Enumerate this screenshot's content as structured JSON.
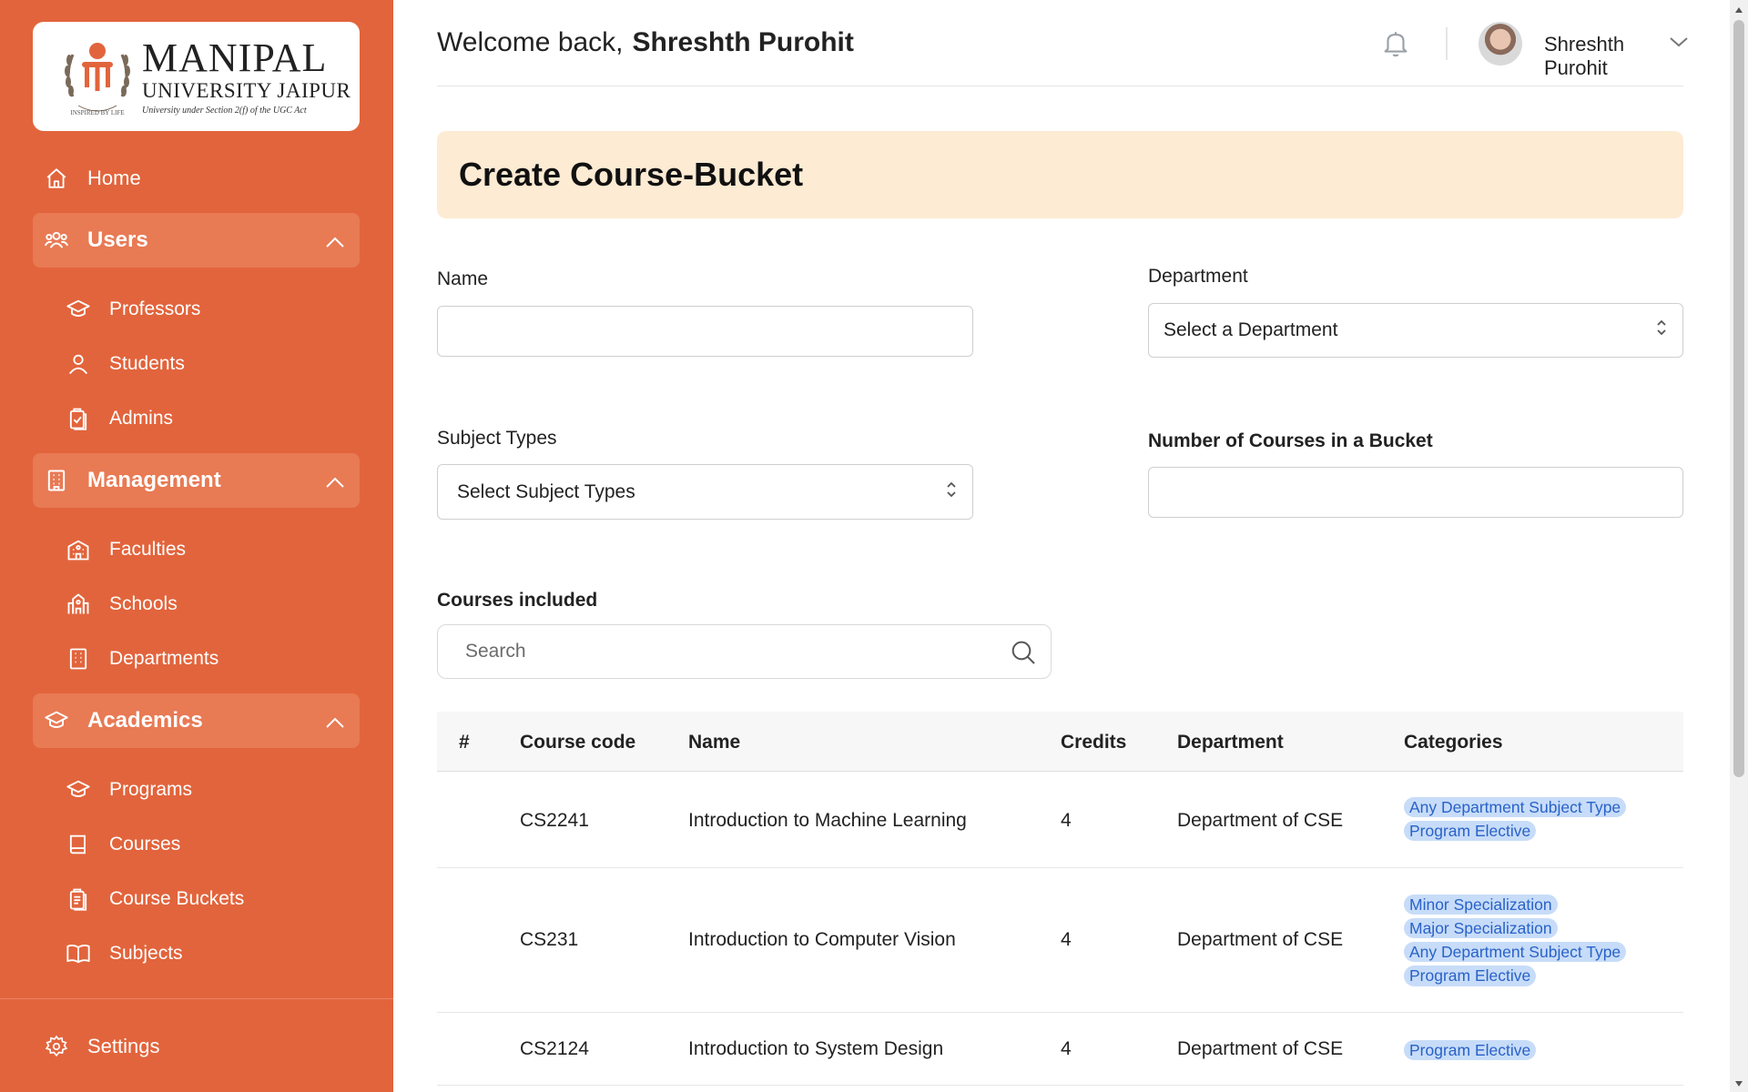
{
  "logo": {
    "line1": "MANIPAL",
    "line2": "UNIVERSITY JAIPUR",
    "line3": "University under Section 2(f) of the UGC Act",
    "tagline": "INSPIRED BY LIFE"
  },
  "sidebar": {
    "home": "Home",
    "users": {
      "label": "Users",
      "items": [
        "Professors",
        "Students",
        "Admins"
      ]
    },
    "management": {
      "label": "Management",
      "items": [
        "Faculties",
        "Schools",
        "Departments"
      ]
    },
    "academics": {
      "label": "Academics",
      "items": [
        "Programs",
        "Courses",
        "Course Buckets",
        "Subjects"
      ]
    },
    "settings": "Settings"
  },
  "header": {
    "welcome": "Welcome back,",
    "user_name": "Shreshth Purohit",
    "profile_name": "Shreshth Purohit"
  },
  "page": {
    "title": "Create Course-Bucket"
  },
  "form": {
    "name_label": "Name",
    "name_value": "",
    "department_label": "Department",
    "department_value": "Select a Department",
    "subject_types_label": "Subject Types",
    "subject_types_value": "Select Subject Types",
    "num_courses_label": "Number of Courses in a Bucket",
    "num_courses_value": "",
    "courses_included_label": "Courses included",
    "search_placeholder": "Search"
  },
  "table": {
    "headers": [
      "#",
      "Course code",
      "Name",
      "Credits",
      "Department",
      "Categories"
    ],
    "rows": [
      {
        "code": "CS2241",
        "name": "Introduction to Machine Learning",
        "credits": "4",
        "department": "Department of CSE",
        "categories": [
          "Any Department Subject Type",
          "Program Elective"
        ]
      },
      {
        "code": "CS231",
        "name": "Introduction to Computer Vision",
        "credits": "4",
        "department": "Department of CSE",
        "categories": [
          "Minor Specialization",
          "Major Specialization",
          "Any Department Subject Type",
          "Program Elective"
        ]
      },
      {
        "code": "CS2124",
        "name": "Introduction to System Design",
        "credits": "4",
        "department": "Department of CSE",
        "categories": [
          "Program Elective"
        ]
      }
    ]
  },
  "colors": {
    "sidebar": "#e2643c",
    "sidebar_group": "#e87a54",
    "banner": "#fdebd3",
    "badge_bg": "#c7dcf8",
    "badge_text": "#2962c8"
  }
}
